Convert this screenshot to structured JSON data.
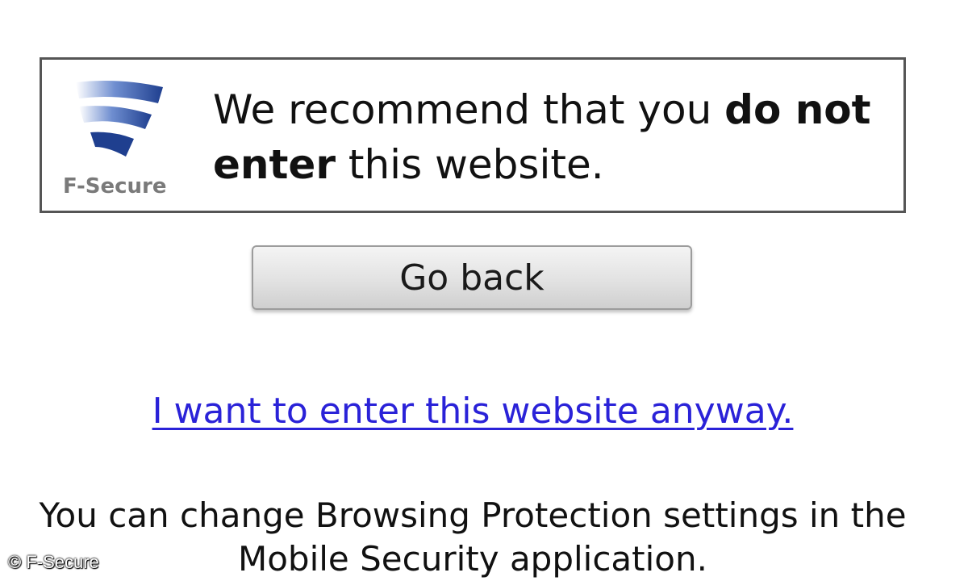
{
  "warning": {
    "logo_text": "F-Secure",
    "headline_part1": "We recommend that you ",
    "headline_bold": "do not enter",
    "headline_part2": " this website."
  },
  "actions": {
    "go_back_label": "Go back",
    "enter_anyway_label": "I want to enter this website anyway."
  },
  "info": {
    "line1": "You can change Browsing Protection settings in the",
    "line2": "Mobile Security application."
  },
  "watermark": {
    "text": "© F-Secure"
  },
  "colors": {
    "link": "#2a22d8",
    "logo_blue": "#1f3f8f",
    "border": "#555555"
  }
}
